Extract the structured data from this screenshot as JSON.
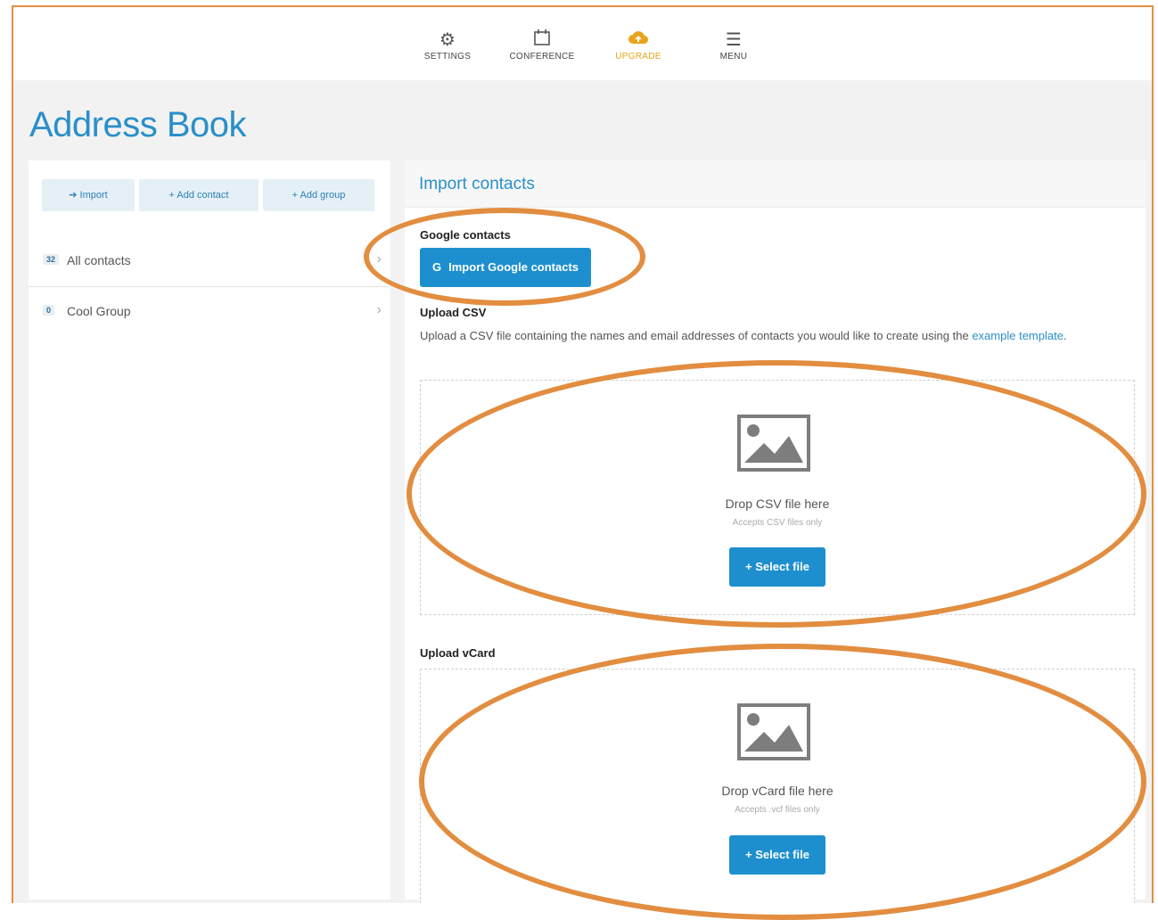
{
  "nav": {
    "items": [
      {
        "label": "SETTINGS",
        "icon": "gear-icon"
      },
      {
        "label": "CONFERENCE",
        "icon": "calendar-icon"
      },
      {
        "label": "UPGRADE",
        "icon": "cloud-upload-icon"
      },
      {
        "label": "MENU",
        "icon": "hamburger-menu-icon"
      }
    ]
  },
  "page": {
    "title": "Address Book"
  },
  "left": {
    "buttons": {
      "import": "➔ Import",
      "add_contact": "+ Add contact",
      "add_group": "+ Add group"
    },
    "groups": [
      {
        "count": "32",
        "name": "All contacts"
      },
      {
        "count": "0",
        "name": "Cool Group"
      }
    ]
  },
  "right": {
    "heading": "Import contacts",
    "google": {
      "label": "Google contacts",
      "button": "Import Google contacts",
      "button_icon": "G"
    },
    "csv": {
      "label": "Upload CSV",
      "desc": "Upload a CSV file containing the names and email addresses of contacts you would like to create using the",
      "link": "example template",
      "desc_end": ".",
      "drop_text": "Drop CSV file here",
      "accepts": "Accepts CSV files only",
      "button": "+ Select file"
    },
    "vcard": {
      "label": "Upload vCard",
      "drop_text": "Drop vCard file here",
      "accepts": "Accepts .vcf files only",
      "button": "+ Select file"
    }
  },
  "colors": {
    "accent": "#2a8fc9",
    "button": "#1e8fce",
    "upgrade": "#e8a21c",
    "annotation": "#e28d40"
  }
}
